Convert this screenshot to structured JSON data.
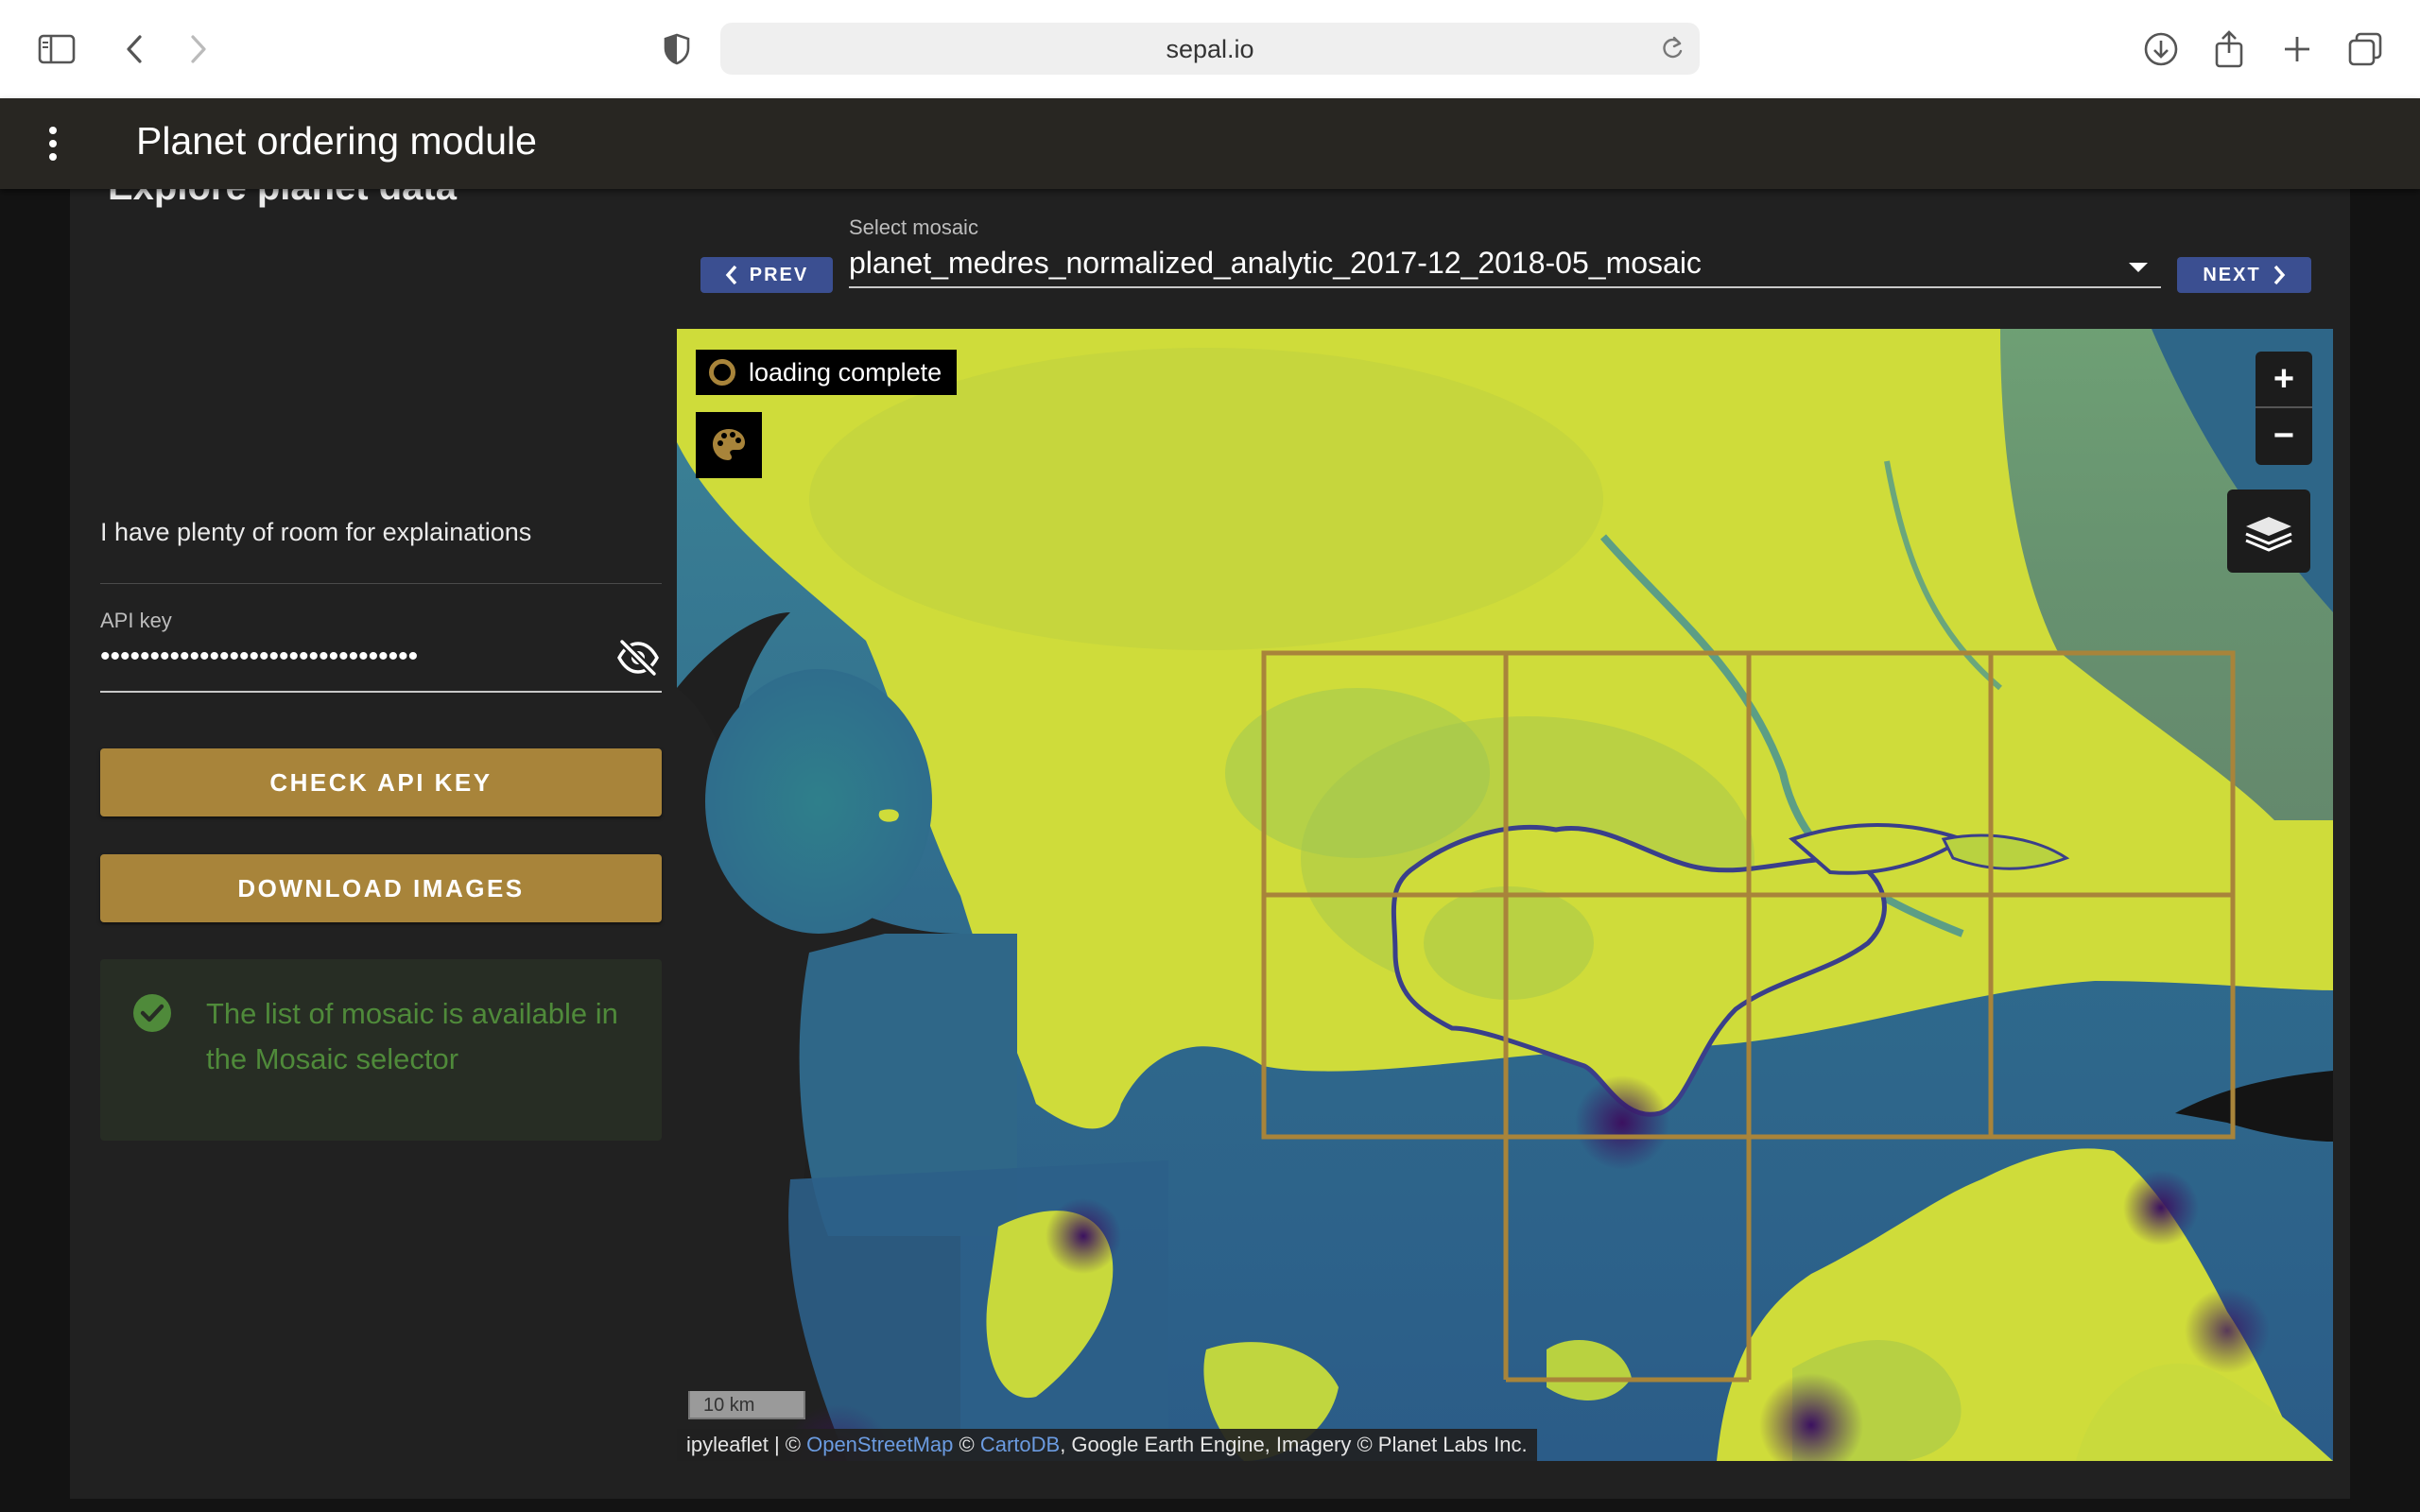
{
  "browser": {
    "url": "sepal.io",
    "icons": [
      "sidebar-icon",
      "back-icon",
      "forward-icon",
      "shield-icon",
      "reload-icon",
      "download-icon",
      "share-icon",
      "new-tab-icon",
      "tabs-icon"
    ]
  },
  "app": {
    "title": "Planet ordering module",
    "section_title": "Explore planet data"
  },
  "left_panel": {
    "explanation": "I have plenty of room for explainations",
    "api_key": {
      "label": "API key",
      "value": "••••••••••••••••••••••••••••••••"
    },
    "check_button": "CHECK API KEY",
    "download_button": "DOWNLOAD IMAGES",
    "alert": {
      "text": "The list of mosaic is available in the Mosaic selector",
      "color": "#4f8a3a"
    }
  },
  "mosaic_selector": {
    "prev_label": "PREV",
    "next_label": "NEXT",
    "label": "Select mosaic",
    "value": "planet_medres_normalized_analytic_2017-12_2018-05_mosaic"
  },
  "map": {
    "status": "loading complete",
    "zoom_in": "+",
    "zoom_out": "−",
    "scale": "10 km",
    "attribution": {
      "prefix": "ipyleaflet | © ",
      "osm": "OpenStreetMap",
      "middle": " © ",
      "carto": "CartoDB",
      "suffix": ", Google Earth Engine, Imagery © Planet Labs Inc."
    },
    "colors": {
      "accent": "#a8843a",
      "land": "#cfdc3a",
      "water": "#2f6e8e"
    }
  }
}
